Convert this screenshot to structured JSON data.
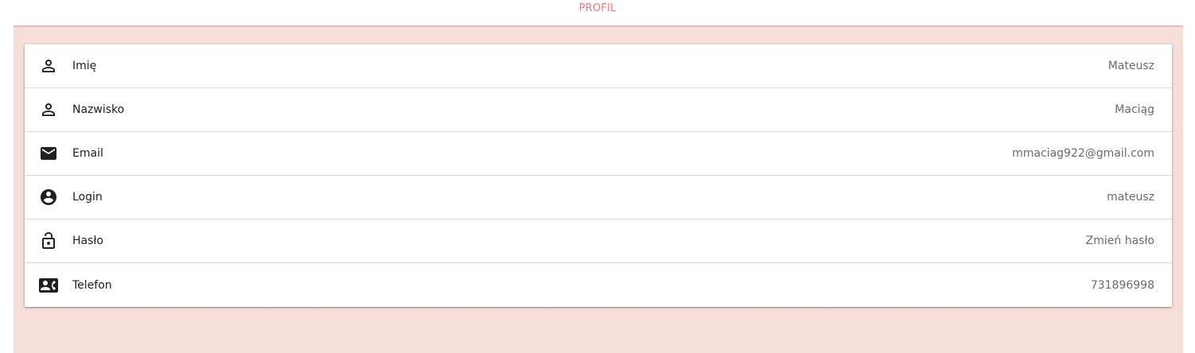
{
  "header": {
    "title": "PROFIL"
  },
  "profile": {
    "rows": [
      {
        "icon": "person-outline-icon",
        "label": "Imię",
        "value": "Mateusz"
      },
      {
        "icon": "person-outline-icon",
        "label": "Nazwisko",
        "value": "Maciąg"
      },
      {
        "icon": "email-icon",
        "label": "Email",
        "value": "mmaciag922@gmail.com"
      },
      {
        "icon": "account-circle-icon",
        "label": "Login",
        "value": "mateusz"
      },
      {
        "icon": "lock-open-icon",
        "label": "Hasło",
        "value": "Zmień hasło"
      },
      {
        "icon": "contact-phone-icon",
        "label": "Telefon",
        "value": "731896998"
      }
    ]
  },
  "colors": {
    "accent": "#f0787a",
    "panel_background": "#f6dfd9",
    "panel_border": "#f3b7b1"
  }
}
